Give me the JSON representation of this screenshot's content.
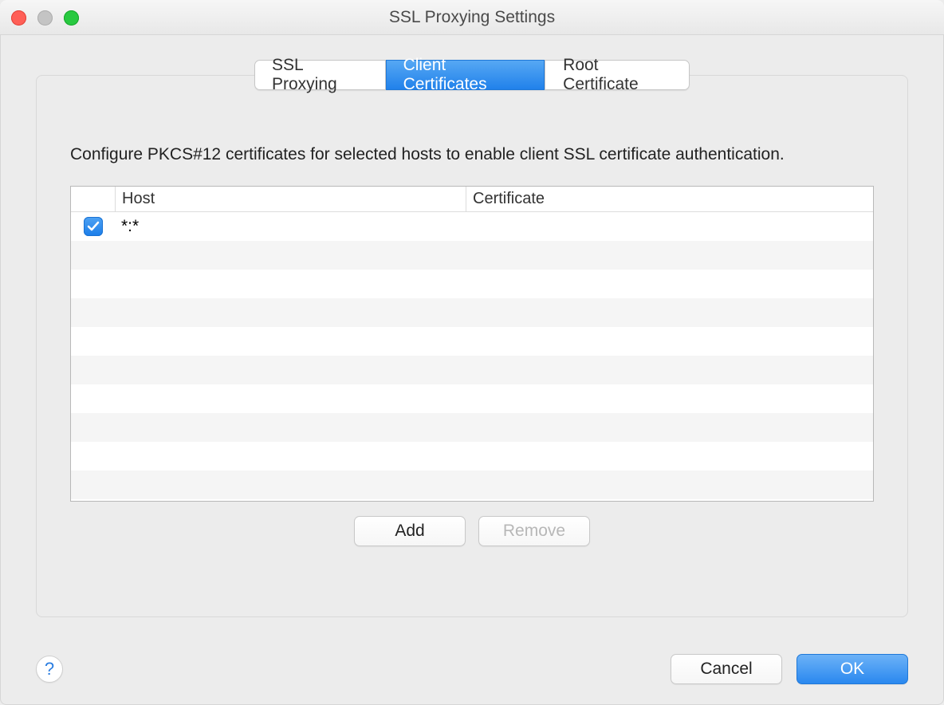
{
  "window": {
    "title": "SSL Proxying Settings"
  },
  "tabs": {
    "ssl_proxying": "SSL Proxying",
    "client_certificates": "Client Certificates",
    "root_certificate": "Root Certificate",
    "active_index": 1
  },
  "description": "Configure PKCS#12 certificates for selected hosts to enable client SSL certificate authentication.",
  "table": {
    "headers": {
      "host": "Host",
      "certificate": "Certificate"
    },
    "rows": [
      {
        "enabled": true,
        "host": "*:*",
        "certificate": ""
      }
    ]
  },
  "actions": {
    "add": "Add",
    "remove": "Remove"
  },
  "footer": {
    "help": "?",
    "cancel": "Cancel",
    "ok": "OK"
  }
}
